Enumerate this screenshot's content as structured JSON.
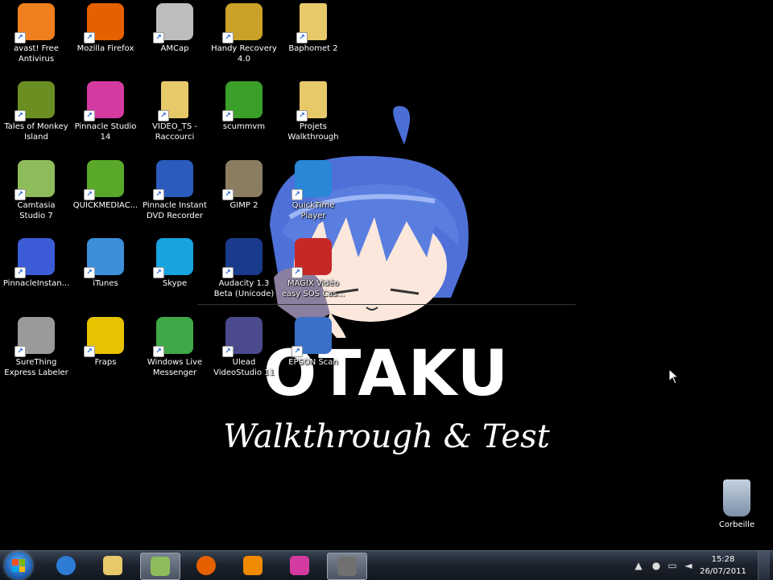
{
  "desktop": {
    "icons": [
      {
        "label": "avast! Free\nAntivirus",
        "icon": "avast-icon",
        "color": "#f07f1d"
      },
      {
        "label": "Mozilla Firefox",
        "icon": "firefox-icon",
        "color": "#e66000"
      },
      {
        "label": "AMCap",
        "icon": "amcap-icon",
        "color": "#bdbdbd"
      },
      {
        "label": "Handy Recovery\n4.0",
        "icon": "handy-recovery-icon",
        "color": "#c9a227"
      },
      {
        "label": "Baphomet 2",
        "icon": "folder-icon",
        "color": "#e8c96a"
      },
      {
        "label": "Tales of Monkey\nIsland",
        "icon": "monkey-island-icon",
        "color": "#6b8e23"
      },
      {
        "label": "Pinnacle Studio\n14",
        "icon": "pinnacle-studio-icon",
        "color": "#d43aa0"
      },
      {
        "label": "VIDEO_TS -\nRaccourci",
        "icon": "folder-icon",
        "color": "#e8c96a"
      },
      {
        "label": "scummvm",
        "icon": "scummvm-icon",
        "color": "#3aa02a"
      },
      {
        "label": "Projets\nWalkthrough",
        "icon": "folder-icon",
        "color": "#e8c96a"
      },
      {
        "label": "Camtasia\nStudio 7",
        "icon": "camtasia-icon",
        "color": "#8fbc5a"
      },
      {
        "label": "QUICKMEDIAC...",
        "icon": "quickmedia-icon",
        "color": "#5aa82a"
      },
      {
        "label": "Pinnacle Instant\nDVD Recorder",
        "icon": "pinnacle-dvd-icon",
        "color": "#2a5bbd"
      },
      {
        "label": "GIMP 2",
        "icon": "gimp-icon",
        "color": "#8a7d60"
      },
      {
        "label": "QuickTime\nPlayer",
        "icon": "quicktime-icon",
        "color": "#2a86d6"
      },
      {
        "label": "PinnacleInstan...",
        "icon": "pinnacle-instant-icon",
        "color": "#3c5bd6"
      },
      {
        "label": "iTunes",
        "icon": "itunes-icon",
        "color": "#3d8fdc"
      },
      {
        "label": "Skype",
        "icon": "skype-icon",
        "color": "#16a3e0"
      },
      {
        "label": "Audacity 1.3\nBeta (Unicode)",
        "icon": "audacity-icon",
        "color": "#1a3a8c"
      },
      {
        "label": "MAGIX Vidéo\neasy SOS Cas...",
        "icon": "magix-icon",
        "color": "#c62828"
      },
      {
        "label": "SureThing\nExpress Labeler",
        "icon": "surething-icon",
        "color": "#9a9a9a"
      },
      {
        "label": "Fraps",
        "icon": "fraps-icon",
        "color": "#e6c200"
      },
      {
        "label": "Windows Live\nMessenger",
        "icon": "messenger-icon",
        "color": "#3fa848"
      },
      {
        "label": "Ulead\nVideoStudio 11",
        "icon": "ulead-icon",
        "color": "#4a4a8c"
      },
      {
        "label": "EPSON Scan",
        "icon": "epson-scan-icon",
        "color": "#3b6fc8"
      }
    ],
    "recycle_bin": {
      "label": "Corbeille",
      "icon": "recycle-bin-icon",
      "color": "#8aa0b8"
    }
  },
  "wallpaper": {
    "title": "OTAKU",
    "subtitle": "Walkthrough & Test"
  },
  "taskbar": {
    "pinned": [
      {
        "icon": "ie-icon",
        "color": "#2e7bd6"
      },
      {
        "icon": "explorer-icon",
        "color": "#e8c96a"
      },
      {
        "icon": "camtasia-icon",
        "color": "#8fbc5a",
        "active": true
      },
      {
        "icon": "firefox-icon",
        "color": "#e66000"
      },
      {
        "icon": "vlc-icon",
        "color": "#f08a00"
      },
      {
        "icon": "pinnacle-studio-icon",
        "color": "#d43aa0"
      },
      {
        "icon": "camtasia-recorder-icon",
        "color": "#707070",
        "active": true
      }
    ],
    "clock": {
      "time": "15:28",
      "date": "26/07/2011"
    }
  }
}
